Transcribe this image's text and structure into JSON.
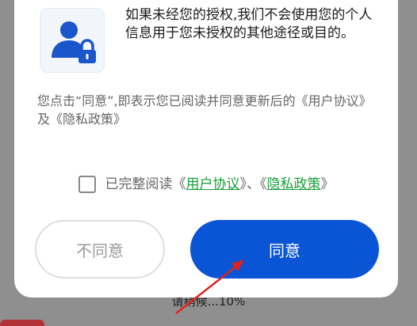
{
  "permission_text": "如果未经您的授权,我们不会使用您的个人信息用于您未授权的其他途径或目的。",
  "consent_text": "您点击“同意”,即表示您已阅读并同意更新后的《用户协议》及《隐私政策》",
  "agreement": {
    "prefix": "已完整阅读《",
    "user_agreement": "用户协议",
    "middle": "》、《",
    "privacy_policy": "隐私政策",
    "suffix": "》"
  },
  "buttons": {
    "disagree": "不同意",
    "agree": "同意"
  },
  "background": {
    "progress_text": "请稍候...10%"
  },
  "colors": {
    "agree_button": "#0a55d6",
    "link": "#17a038",
    "arrow": "#e0221f"
  }
}
